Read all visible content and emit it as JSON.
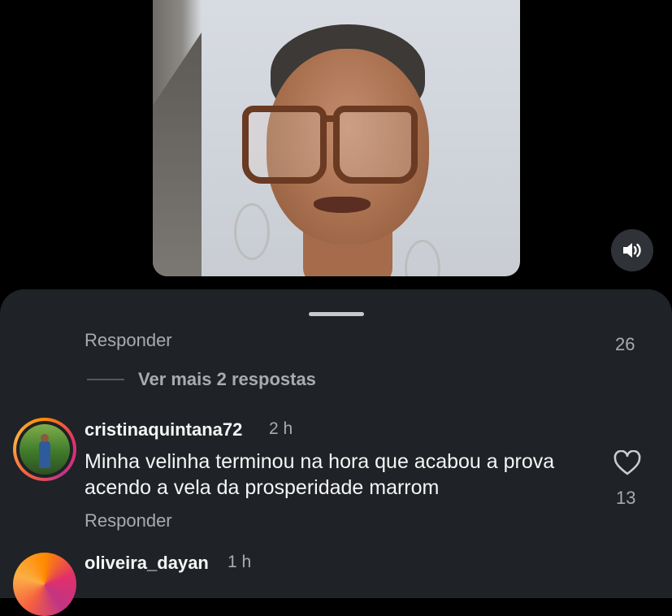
{
  "video": {
    "sound_icon": "speaker-volume-icon"
  },
  "comments_sheet": {
    "previous_reply_label": "Responder",
    "previous_like_count": "26",
    "view_more_replies": "Ver mais 2 respostas",
    "comments": [
      {
        "username": "cristinaquintana72",
        "time": "2 h",
        "text": "Minha velinha terminou na hora que acabou a prova  acendo a vela da  prosperidade marrom",
        "like_count": "13",
        "reply_label": "Responder",
        "like_icon": "heart-outline-icon"
      },
      {
        "username": "oliveira_dayan",
        "time": "1 h"
      }
    ]
  }
}
